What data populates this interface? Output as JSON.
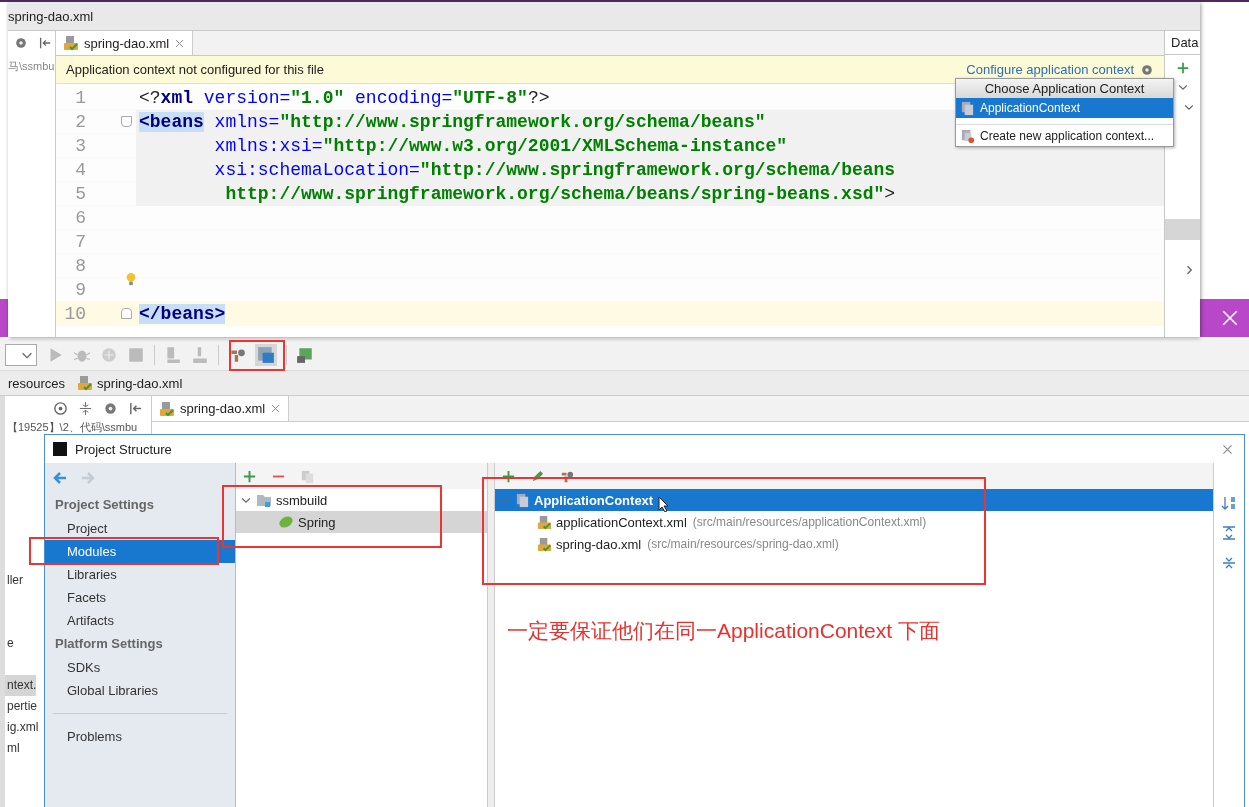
{
  "editor_window": {
    "breadcrumb": "spring-dao.xml",
    "side_text": "马\\ssmbu",
    "tab": {
      "label": "spring-dao.xml",
      "selected": true
    },
    "right_panel_title": "Data",
    "notice": {
      "message": "Application context not configured for this file",
      "link": "Configure application context"
    },
    "lines": [
      {
        "number": "1",
        "shaded": false,
        "current": false,
        "fold_marker": false,
        "bulb": false,
        "tokens": [
          {
            "kind": "punct",
            "text": "<?"
          },
          {
            "kind": "tag",
            "text": "xml"
          },
          {
            "kind": "attr",
            "text": " version="
          },
          {
            "kind": "value",
            "text": "\"1.0\""
          },
          {
            "kind": "attr",
            "text": " encoding="
          },
          {
            "kind": "value",
            "text": "\"UTF-8\""
          },
          {
            "kind": "punct",
            "text": "?>"
          }
        ]
      },
      {
        "number": "2",
        "shaded": true,
        "current": false,
        "fold_marker": true,
        "bulb": false,
        "tokens": [
          {
            "kind": "tag_match",
            "text": "<beans"
          },
          {
            "kind": "attr",
            "text": " xmlns="
          },
          {
            "kind": "value",
            "text": "\"http://www.springframework.org/schema/beans\""
          }
        ]
      },
      {
        "number": "3",
        "shaded": true,
        "current": false,
        "fold_marker": false,
        "bulb": false,
        "tokens": [
          {
            "kind": "attr",
            "text": "       xmlns:xsi="
          },
          {
            "kind": "value",
            "text": "\"http://www.w3.org/2001/XMLSchema-instance\""
          }
        ]
      },
      {
        "number": "4",
        "shaded": true,
        "current": false,
        "fold_marker": false,
        "bulb": false,
        "tokens": [
          {
            "kind": "attr",
            "text": "       xsi:schemaLocation="
          },
          {
            "kind": "value",
            "text": "\"http://www.springframework.org/schema/beans"
          }
        ]
      },
      {
        "number": "5",
        "shaded": true,
        "current": false,
        "fold_marker": false,
        "bulb": false,
        "tokens": [
          {
            "kind": "value",
            "text": "        http://www.springframework.org/schema/beans/spring-beans.xsd\""
          },
          {
            "kind": "punct",
            "text": ">"
          }
        ]
      },
      {
        "number": "6",
        "shaded": false,
        "current": false,
        "fold_marker": false,
        "bulb": false
      },
      {
        "number": "7",
        "shaded": false,
        "current": false,
        "fold_marker": false,
        "bulb": false
      },
      {
        "number": "8",
        "shaded": false,
        "current": false,
        "fold_marker": false,
        "bulb": false
      },
      {
        "number": "9",
        "shaded": false,
        "current": false,
        "fold_marker": false,
        "bulb": true
      },
      {
        "number": "10",
        "shaded": false,
        "current": true,
        "fold_marker": true,
        "bulb": false,
        "tokens": [
          {
            "kind": "tag_match",
            "text": "</beans>"
          }
        ]
      }
    ],
    "context_menu": {
      "title": "Choose Application Context",
      "items": [
        {
          "label": "ApplicationContext",
          "selected": true,
          "kind": "context"
        },
        {
          "label": "Create new application context...",
          "selected": false,
          "kind": "create"
        }
      ]
    }
  },
  "ide_background": {
    "project_rows": [
      {
        "text": "【19525】\\2、代码\\ssmbu",
        "selected": false
      },
      {
        "text": "ller",
        "selected": false
      },
      {
        "text": "e",
        "selected": false
      },
      {
        "text": "ntext.",
        "selected": true
      },
      {
        "text": "pertie",
        "selected": false
      },
      {
        "text": "ig.xml",
        "selected": false
      },
      {
        "text": "ml",
        "selected": false
      }
    ],
    "breadcrumbs": [
      "resources",
      "spring-dao.xml"
    ],
    "tab": {
      "label": "spring-dao.xml",
      "selected": true
    }
  },
  "project_structure": {
    "title": "Project Structure",
    "nav": [
      {
        "heading": "Project Settings",
        "items": [
          {
            "label": "Project",
            "selected": false
          },
          {
            "label": "Modules",
            "selected": true
          },
          {
            "label": "Libraries",
            "selected": false
          },
          {
            "label": "Facets",
            "selected": false
          },
          {
            "label": "Artifacts",
            "selected": false
          }
        ]
      },
      {
        "heading": "Platform Settings",
        "items": [
          {
            "label": "SDKs",
            "selected": false
          },
          {
            "label": "Global Libraries",
            "selected": false
          }
        ]
      },
      {
        "items": [
          {
            "label": "Problems",
            "selected": false
          }
        ]
      }
    ],
    "modules_tree": [
      {
        "label": "ssmbuild",
        "expanded": true,
        "selected": false,
        "children": [
          {
            "label": "Spring",
            "selected": true
          }
        ]
      }
    ],
    "context_tree": [
      {
        "label": "ApplicationContext",
        "expanded": true,
        "selected": true,
        "children": [
          {
            "label": "applicationContext.xml",
            "path": "(src/main/resources/applicationContext.xml)",
            "selected": false
          },
          {
            "label": "spring-dao.xml",
            "path": "(src/main/resources/spring-dao.xml)",
            "selected": false
          }
        ]
      }
    ],
    "annotation": "一定要保证他们在同一ApplicationContext 下面"
  }
}
